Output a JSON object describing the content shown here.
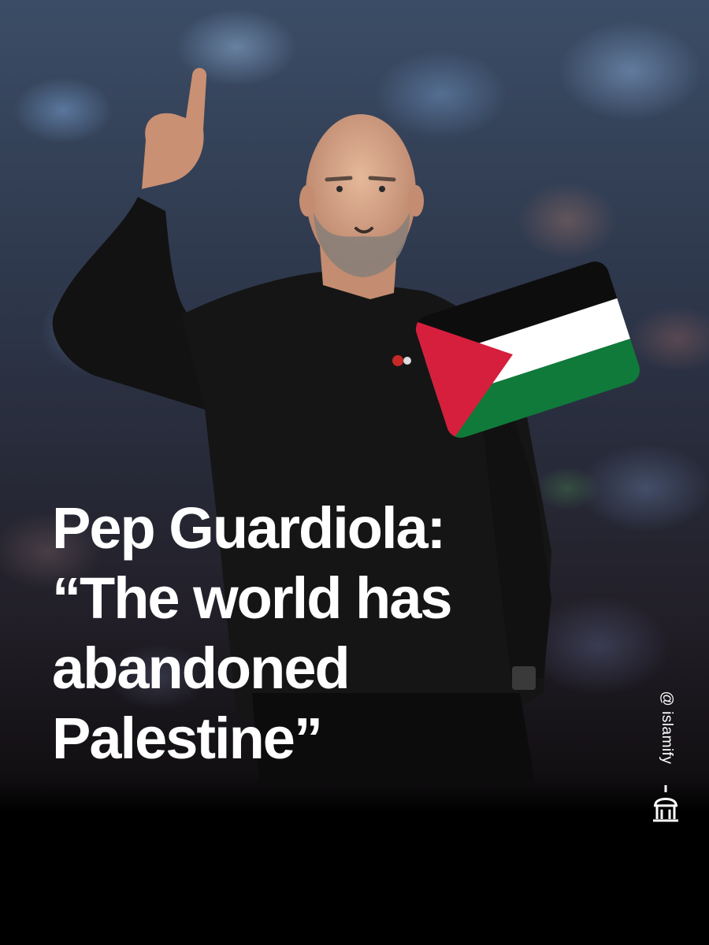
{
  "headline": {
    "line1": "Pep Guardiola:",
    "line2": "“The world has",
    "line3": "abandoned",
    "line4": "Palestine”"
  },
  "handle": "@ islamify",
  "flag": {
    "icon": "palestine-flag-icon",
    "colors": {
      "black": "#0d0d0d",
      "white": "#ffffff",
      "green": "#0f7a3a",
      "red": "#d61f3c"
    }
  },
  "logo": {
    "icon": "islamify-mosque-logo-icon"
  },
  "accent": {
    "text": "#ffffff",
    "background": "#000000"
  }
}
